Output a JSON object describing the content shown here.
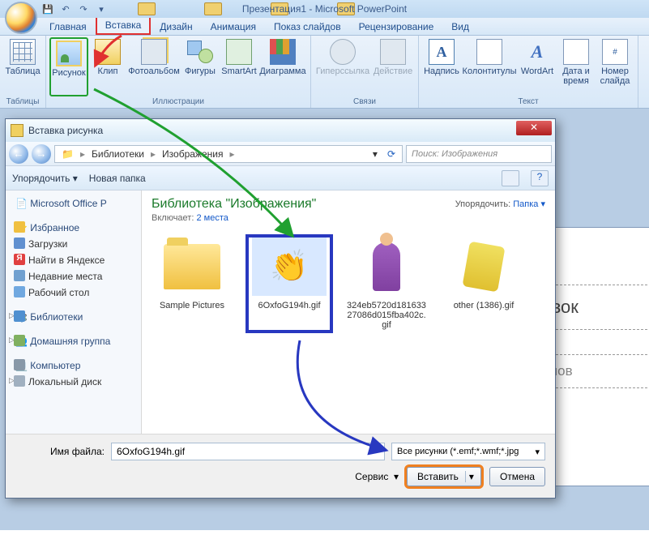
{
  "app": {
    "title": "Презентация1 - Microsoft PowerPoint"
  },
  "tabs": {
    "home": "Главная",
    "insert": "Вставка",
    "design": "Дизайн",
    "anim": "Анимация",
    "show": "Показ слайдов",
    "review": "Рецензирование",
    "view": "Вид"
  },
  "ribbon": {
    "table": "Таблица",
    "tables_grp": "Таблицы",
    "picture": "Рисунок",
    "clip": "Клип",
    "album": "Фотоальбом",
    "shapes": "Фигуры",
    "smartart": "SmartArt",
    "chart": "Диаграмма",
    "illus_grp": "Иллюстрации",
    "hyperlink": "Гиперссылка",
    "action": "Действие",
    "links_grp": "Связи",
    "textbox": "Надпись",
    "headerfooter": "Колонтитулы",
    "wordart": "WordArt",
    "datetime": "Дата и время",
    "slidenum": "Номер слайда",
    "text_grp": "Текст"
  },
  "slide": {
    "title_ph": "головок",
    "sub_ph": "дзаголов"
  },
  "dialog": {
    "title": "Вставка рисунка",
    "crumb1": "Библиотеки",
    "crumb2": "Изображения",
    "search_ph": "Поиск: Изображения",
    "organize": "Упорядочить",
    "newfolder": "Новая папка",
    "lib_heading": "Библиотека \"Изображения\"",
    "includes": "Включает:",
    "includes_link": "2 места",
    "arrange": "Упорядочить:",
    "arrange_val": "Папка",
    "sidebar": {
      "office": "Microsoft Office P",
      "fav": "Избранное",
      "downloads": "Загрузки",
      "yandex": "Найти в Яндексе",
      "recent": "Недавние места",
      "desktop": "Рабочий стол",
      "libraries": "Библиотеки",
      "homegroup": "Домашняя группа",
      "computer": "Компьютер",
      "localdisk": "Локальный диск"
    },
    "files": {
      "f1": "Sample Pictures",
      "f2": "6OxfoG194h.gif",
      "f3": "324eb5720d18163327086d015fba402c.gif",
      "f4": "other (1386).gif"
    },
    "filename_lbl": "Имя файла:",
    "filename_val": "6OxfoG194h.gif",
    "filter": "Все рисунки (*.emf;*.wmf;*.jpg",
    "service": "Сервис",
    "insert_btn": "Вставить",
    "cancel_btn": "Отмена"
  }
}
